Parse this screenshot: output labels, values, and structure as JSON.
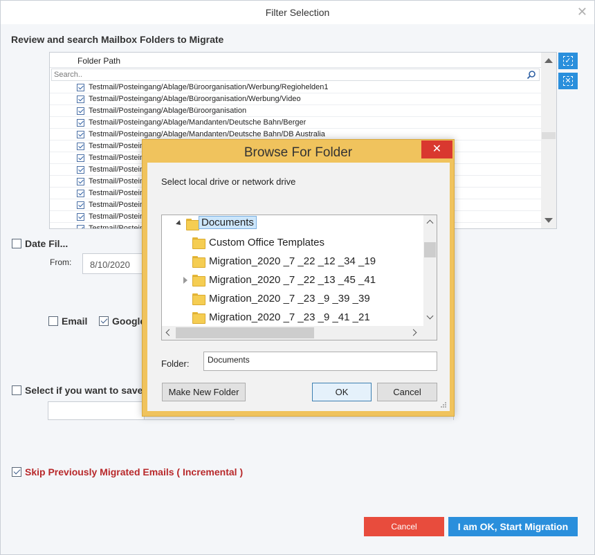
{
  "window": {
    "title": "Filter Selection"
  },
  "folders_section": {
    "title": "Review and search Mailbox Folders to Migrate",
    "column_header": "Folder Path",
    "search_placeholder": "Search..",
    "rows": [
      "Testmail/Posteingang/Ablage/Büroorganisation/Werbung/Regiohelden1",
      "Testmail/Posteingang/Ablage/Büroorganisation/Werbung/Video",
      "Testmail/Posteingang/Ablage/Büroorganisation",
      "Testmail/Posteingang/Ablage/Mandanten/Deutsche Bahn/Berger",
      "Testmail/Posteingang/Ablage/Mandanten/Deutsche Bahn/DB Australia",
      "Testmail/Posteing",
      "Testmail/Posteing",
      "Testmail/Posteing",
      "Testmail/Posteing",
      "Testmail/Posteing",
      "Testmail/Posteing",
      "Testmail/Posteing",
      "Testmail/Posteing"
    ]
  },
  "date_filter": {
    "label": "Date Fil...",
    "from_label": "From:",
    "from_value": "8/10/2020"
  },
  "types": {
    "email_label": "Email",
    "google_label": "Google"
  },
  "save_option": {
    "label": "Select if you want to save"
  },
  "incremental": {
    "label": "Skip Previously Migrated Emails ( Incremental )"
  },
  "footer": {
    "cancel_label": "Cancel",
    "start_label": "I am OK, Start Migration"
  },
  "browse_dialog": {
    "title": "Browse For Folder",
    "close_glyph": "✕",
    "prompt": "Select local drive or network drive",
    "tree": [
      {
        "name": "Documents"
      },
      {
        "name": "Custom Office Templates"
      },
      {
        "name": "Migration_2020 _7 _22 _12 _34 _19"
      },
      {
        "name": "Migration_2020 _7 _22 _13 _45 _41"
      },
      {
        "name": "Migration_2020 _7 _23 _9 _39 _39"
      },
      {
        "name": "Migration_2020 _7 _23 _9 _41 _21"
      }
    ],
    "folder_label": "Folder:",
    "folder_value": "Documents",
    "make_new_folder_label": "Make New Folder",
    "ok_label": "OK",
    "cancel_label": "Cancel"
  },
  "colors": {
    "accent": "#2a8fdc",
    "danger": "#e84c3d",
    "dialog_frame": "#f0c35d"
  }
}
